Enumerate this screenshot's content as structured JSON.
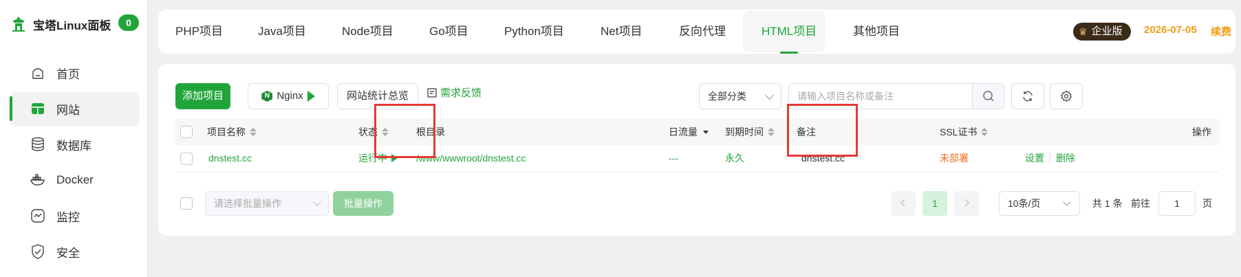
{
  "brand": {
    "name": "宝塔Linux面板",
    "badge": "0"
  },
  "sidebar": {
    "items": [
      {
        "label": "首页",
        "icon": "home-icon"
      },
      {
        "label": "网站",
        "icon": "website-icon",
        "active": true
      },
      {
        "label": "数据库",
        "icon": "database-icon"
      },
      {
        "label": "Docker",
        "icon": "docker-icon"
      },
      {
        "label": "监控",
        "icon": "monitor-icon"
      },
      {
        "label": "安全",
        "icon": "shield-icon"
      }
    ]
  },
  "tabs": [
    "PHP项目",
    "Java项目",
    "Node项目",
    "Go项目",
    "Python项目",
    "Net项目",
    "反向代理",
    "HTML项目",
    "其他项目"
  ],
  "active_tab": "HTML项目",
  "header": {
    "edition": "企业版",
    "expire_date": "2026-07-05",
    "renew": "续费"
  },
  "toolbar": {
    "add_project": "添加项目",
    "nginx": "Nginx",
    "site_stats": "网站统计总览",
    "feedback": "需求反馈",
    "category": "全部分类",
    "search_placeholder": "请输入项目名称或备注"
  },
  "table": {
    "columns": {
      "name": "项目名称",
      "status": "状态",
      "root": "根目录",
      "traffic": "日流量",
      "expire": "到期时间",
      "remark": "备注",
      "ssl": "SSL证书",
      "actions": "操作"
    },
    "rows": [
      {
        "name": "dnstest.cc",
        "status": "运行中",
        "root": "/www/wwwroot/dnstest.cc",
        "traffic": "---",
        "expire": "永久",
        "remark": "dnstest.cc",
        "ssl": "未部署",
        "action_settings": "设置",
        "action_delete": "删除"
      }
    ]
  },
  "footer": {
    "batch_placeholder": "请选择批量操作",
    "batch_button": "批量操作",
    "current_page": "1",
    "page_size": "10条/页",
    "total": "共 1 条",
    "goto_prefix": "前往",
    "goto_value": "1",
    "goto_suffix": "页"
  },
  "colors": {
    "brand_green": "#20a53a",
    "warning_orange": "#f39c12",
    "highlight_red": "#e53935"
  }
}
